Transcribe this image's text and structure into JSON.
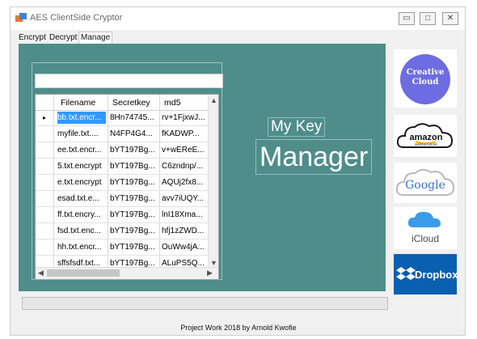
{
  "window": {
    "title": "AES ClientSide Cryptor",
    "minimize_glyph": "▭",
    "maximize_glyph": "□",
    "close_glyph": "✕"
  },
  "tabs": [
    {
      "label": "Encrypt"
    },
    {
      "label": "Decrypt"
    },
    {
      "label": "Manage Keys"
    }
  ],
  "active_tab": "Manage Keys",
  "search": {
    "value": "",
    "placeholder": ""
  },
  "table": {
    "columns": [
      "Filename",
      "Secretkey",
      "md5"
    ],
    "rows": [
      {
        "filename": "bb.txt.encr...",
        "secretkey": "8Hn74745...",
        "md5": "rv+1FjxwJ..."
      },
      {
        "filename": "myfile.txt....",
        "secretkey": "N4FP4G4...",
        "md5": "fKADWP..."
      },
      {
        "filename": "ee.txt.encr...",
        "secretkey": "bYT197Bg...",
        "md5": "v+wEReE..."
      },
      {
        "filename": "5.txt.encrypt",
        "secretkey": "bYT197Bg...",
        "md5": "C6zndnp/..."
      },
      {
        "filename": "e.txt.encrypt",
        "secretkey": "bYT197Bg...",
        "md5": "AQUj2fx8..."
      },
      {
        "filename": "esad.txt.e...",
        "secretkey": "bYT197Bg...",
        "md5": "avv7iUQY..."
      },
      {
        "filename": "ff.txt.encry...",
        "secretkey": "bYT197Bg...",
        "md5": "lnI18Xma..."
      },
      {
        "filename": "fsd.txt.enc...",
        "secretkey": "bYT197Bg...",
        "md5": "hfj1zZWD..."
      },
      {
        "filename": "hh.txt.encr...",
        "secretkey": "bYT197Bg...",
        "md5": "OuWw4jA..."
      },
      {
        "filename": "sffsfsdf.txt...",
        "secretkey": "bYT197Bg...",
        "md5": "ALuPS5Q..."
      }
    ],
    "selected_row": 0,
    "row_indicator": "▸"
  },
  "labels": {
    "my_key": "My Key",
    "manager": "Manager"
  },
  "services": {
    "creative_cloud": "Creative\nCloud",
    "amazon": "amazon",
    "amazon_sub": "webservices",
    "google": "Google",
    "icloud": "iCloud",
    "dropbox": "Dropbox"
  },
  "footer": "Project Work 2018 by Arnold Kwofie",
  "colors": {
    "panel": "#4f8d8a",
    "selection": "#3399ff",
    "dropbox": "#0b5fb0",
    "creative_cloud": "#6d6ce0"
  }
}
